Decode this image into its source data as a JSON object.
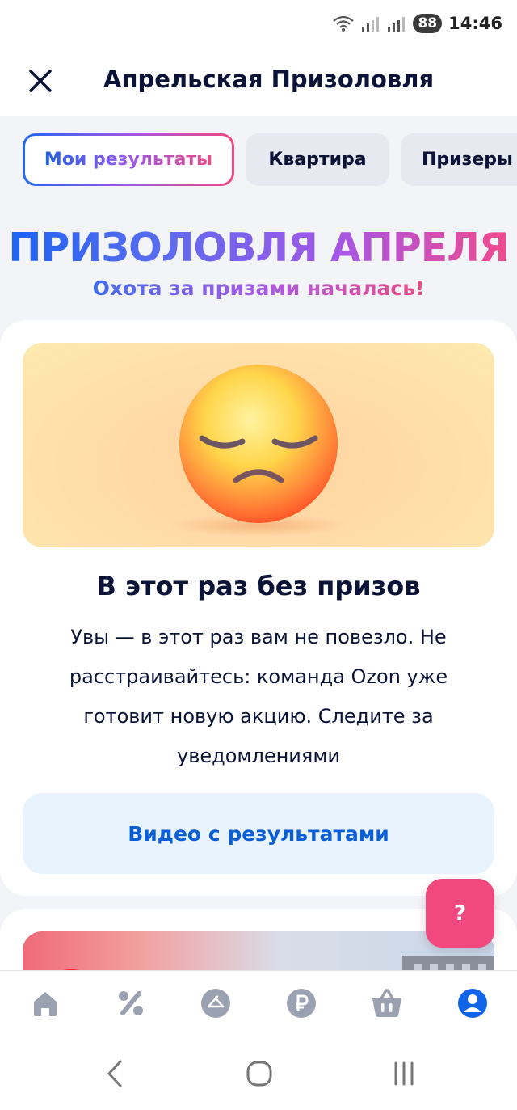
{
  "status_bar": {
    "battery": "88",
    "time": "14:46"
  },
  "header": {
    "title": "Апрельская Призоловля"
  },
  "tabs": [
    {
      "label": "Мои результаты",
      "active": true
    },
    {
      "label": "Квартира",
      "active": false
    },
    {
      "label": "Призеры",
      "active": false
    }
  ],
  "promo": {
    "title": "ПРИЗОЛОВЛЯ АПРЕЛЯ",
    "subtitle": "Охота за призами началась!"
  },
  "result_card": {
    "title": "В этот раз без призов",
    "text": "Увы — в этот раз вам не повезло. Не расстраивайтесь: команда Ozon уже готовит новую акцию. Следите за уведомлениями",
    "video_button": "Видео с результатами"
  },
  "help_button": "?",
  "bottom_nav": [
    {
      "icon": "home-icon"
    },
    {
      "icon": "percent-icon"
    },
    {
      "icon": "hanger-icon"
    },
    {
      "icon": "ruble-icon"
    },
    {
      "icon": "basket-icon"
    },
    {
      "icon": "profile-icon",
      "active": true
    }
  ],
  "colors": {
    "accent_blue": "#0b5fd6",
    "gradient_start": "#1d63f2",
    "gradient_end": "#f14a8c",
    "help_pink": "#f0487f",
    "nav_inactive": "#9aa1b1",
    "nav_active": "#1064e8"
  }
}
